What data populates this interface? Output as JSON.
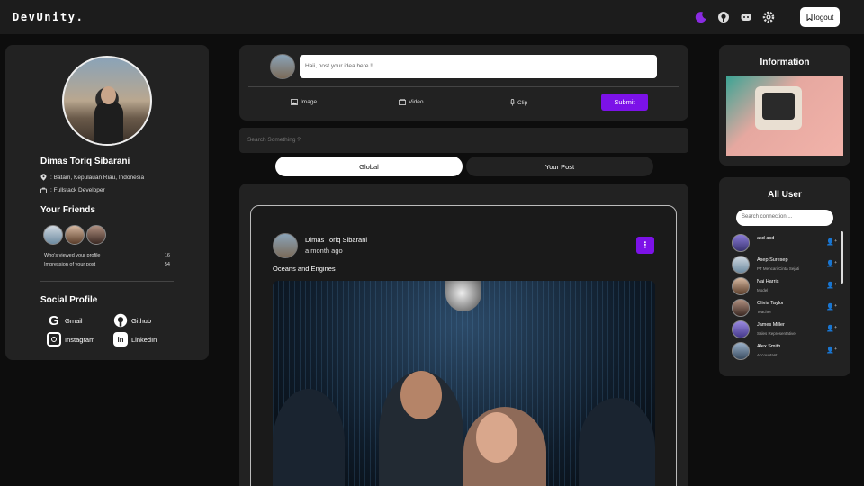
{
  "header": {
    "logo": "DevUnity.",
    "logout_label": "logout"
  },
  "profile": {
    "name": "Dimas Toriq Sibarani",
    "location": ": Batam, Kepulauan Riau, Indonesia",
    "job": ": Fullstack Developer",
    "friends_title": "Your Friends",
    "stats": [
      {
        "label": "Who's viewed your profile",
        "value": "16"
      },
      {
        "label": "Impression of your post",
        "value": "54"
      }
    ],
    "social_title": "Social Profile",
    "social": [
      {
        "label": "Gmail",
        "icon": "gmail-icon"
      },
      {
        "label": "Github",
        "icon": "github-icon"
      },
      {
        "label": "Instagram",
        "icon": "instagram-icon"
      },
      {
        "label": "LinkedIn",
        "icon": "linkedin-icon"
      }
    ]
  },
  "composer": {
    "placeholder": "Haii, post your idea here !!",
    "image_label": "Image",
    "video_label": "Video",
    "clip_label": "Clip",
    "submit_label": "Submit"
  },
  "search": {
    "placeholder": "Search Something ?"
  },
  "tabs": {
    "global": "Global",
    "your_post": "Your Post"
  },
  "post": {
    "author": "Dimas Toriq Sibarani",
    "time": "a month ago",
    "caption": "Oceans and Engines"
  },
  "information": {
    "title": "Information"
  },
  "all_user": {
    "title": "All User",
    "search_placeholder": "Search connection ...",
    "users": [
      {
        "name": "asd asd",
        "job": ""
      },
      {
        "name": "Asep Suresep",
        "job": "PT Mencari Cinta Sejati"
      },
      {
        "name": "Nai Harris",
        "job": "Model"
      },
      {
        "name": "Olivia Taylor",
        "job": "Teacher"
      },
      {
        "name": "James Miller",
        "job": "Sales Representative"
      },
      {
        "name": "Alex Smith",
        "job": "Accountant"
      }
    ]
  },
  "colors": {
    "accent": "#7c12e8",
    "panel": "#222222",
    "background": "#0d0d0d"
  }
}
